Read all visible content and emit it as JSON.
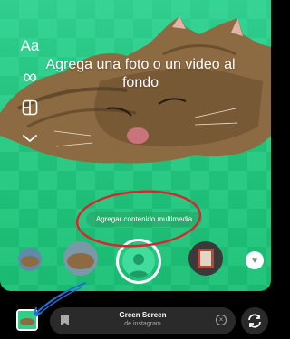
{
  "canvas": {
    "hint_text": "Agrega una foto o un video al fondo",
    "add_media_label": "Agregar contenido multimedia"
  },
  "tools": [
    {
      "name": "text-tool",
      "glyph": "Aa"
    },
    {
      "name": "boomerang-tool",
      "glyph": "∞"
    },
    {
      "name": "layout-tool",
      "glyph": ""
    },
    {
      "name": "more-tools",
      "glyph": ""
    }
  ],
  "effect": {
    "title": "Green Screen",
    "subtitle": "de instagram"
  },
  "colors": {
    "background_green": "#2fcf87",
    "annotation_red": "#d8262e",
    "annotation_blue": "#1e6fd8"
  },
  "icons": [
    "bookmark-icon",
    "clear-icon",
    "flip-camera-icon",
    "heart-icon",
    "person-silhouette-icon",
    "gallery-icon"
  ]
}
